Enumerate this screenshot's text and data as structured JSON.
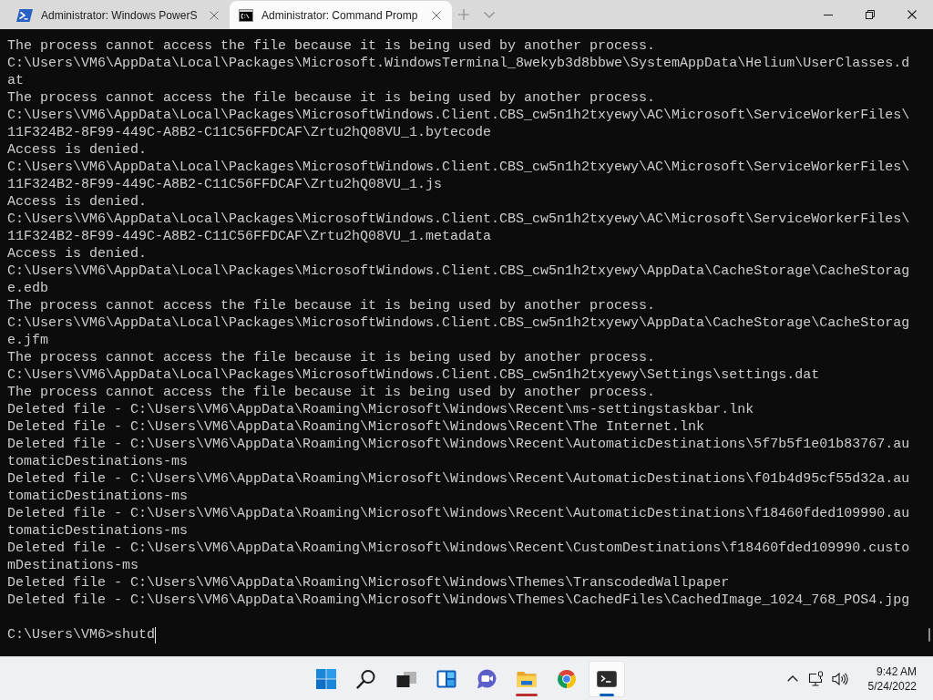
{
  "window": {
    "tabs": [
      {
        "kind": "powershell",
        "title": "Administrator: Windows PowerS",
        "selected": false
      },
      {
        "kind": "cmd",
        "title": "Administrator: Command Promp",
        "selected": true
      }
    ]
  },
  "terminal": {
    "output": [
      "The process cannot access the file because it is being used by another process.",
      "C:\\Users\\VM6\\AppData\\Local\\Packages\\Microsoft.WindowsTerminal_8wekyb3d8bbwe\\SystemAppData\\Helium\\UserClasses.dat",
      "The process cannot access the file because it is being used by another process.",
      "C:\\Users\\VM6\\AppData\\Local\\Packages\\MicrosoftWindows.Client.CBS_cw5n1h2txyewy\\AC\\Microsoft\\ServiceWorkerFiles\\11F324B2-8F99-449C-A8B2-C11C56FFDCAF\\Zrtu2hQ08VU_1.bytecode",
      "Access is denied.",
      "C:\\Users\\VM6\\AppData\\Local\\Packages\\MicrosoftWindows.Client.CBS_cw5n1h2txyewy\\AC\\Microsoft\\ServiceWorkerFiles\\11F324B2-8F99-449C-A8B2-C11C56FFDCAF\\Zrtu2hQ08VU_1.js",
      "Access is denied.",
      "C:\\Users\\VM6\\AppData\\Local\\Packages\\MicrosoftWindows.Client.CBS_cw5n1h2txyewy\\AC\\Microsoft\\ServiceWorkerFiles\\11F324B2-8F99-449C-A8B2-C11C56FFDCAF\\Zrtu2hQ08VU_1.metadata",
      "Access is denied.",
      "C:\\Users\\VM6\\AppData\\Local\\Packages\\MicrosoftWindows.Client.CBS_cw5n1h2txyewy\\AppData\\CacheStorage\\CacheStorage.edb",
      "The process cannot access the file because it is being used by another process.",
      "C:\\Users\\VM6\\AppData\\Local\\Packages\\MicrosoftWindows.Client.CBS_cw5n1h2txyewy\\AppData\\CacheStorage\\CacheStorage.jfm",
      "The process cannot access the file because it is being used by another process.",
      "C:\\Users\\VM6\\AppData\\Local\\Packages\\MicrosoftWindows.Client.CBS_cw5n1h2txyewy\\Settings\\settings.dat",
      "The process cannot access the file because it is being used by another process.",
      "Deleted file - C:\\Users\\VM6\\AppData\\Roaming\\Microsoft\\Windows\\Recent\\ms-settingstaskbar.lnk",
      "Deleted file - C:\\Users\\VM6\\AppData\\Roaming\\Microsoft\\Windows\\Recent\\The Internet.lnk",
      "Deleted file - C:\\Users\\VM6\\AppData\\Roaming\\Microsoft\\Windows\\Recent\\AutomaticDestinations\\5f7b5f1e01b83767.automaticDestinations-ms",
      "Deleted file - C:\\Users\\VM6\\AppData\\Roaming\\Microsoft\\Windows\\Recent\\AutomaticDestinations\\f01b4d95cf55d32a.automaticDestinations-ms",
      "Deleted file - C:\\Users\\VM6\\AppData\\Roaming\\Microsoft\\Windows\\Recent\\AutomaticDestinations\\f18460fded109990.automaticDestinations-ms",
      "Deleted file - C:\\Users\\VM6\\AppData\\Roaming\\Microsoft\\Windows\\Recent\\CustomDestinations\\f18460fded109990.customDestinations-ms",
      "Deleted file - C:\\Users\\VM6\\AppData\\Roaming\\Microsoft\\Windows\\Themes\\TranscodedWallpaper",
      "Deleted file - C:\\Users\\VM6\\AppData\\Roaming\\Microsoft\\Windows\\Themes\\CachedFiles\\CachedImage_1024_768_POS4.jpg"
    ],
    "prompt": "C:\\Users\\VM6>",
    "input": "shutd"
  },
  "taskbar": {
    "apps": [
      {
        "kind": "start",
        "selected": false,
        "attention": false
      },
      {
        "kind": "search",
        "selected": false,
        "attention": false
      },
      {
        "kind": "task-view",
        "selected": false,
        "attention": false
      },
      {
        "kind": "widgets",
        "selected": false,
        "attention": false
      },
      {
        "kind": "chat",
        "selected": false,
        "attention": false
      },
      {
        "kind": "file-explorer",
        "selected": false,
        "attention": true
      },
      {
        "kind": "browser",
        "selected": false,
        "attention": false
      },
      {
        "kind": "terminal",
        "selected": true,
        "attention": false
      }
    ],
    "clock": {
      "time": "9:42 AM",
      "date": "5/24/2022"
    }
  }
}
